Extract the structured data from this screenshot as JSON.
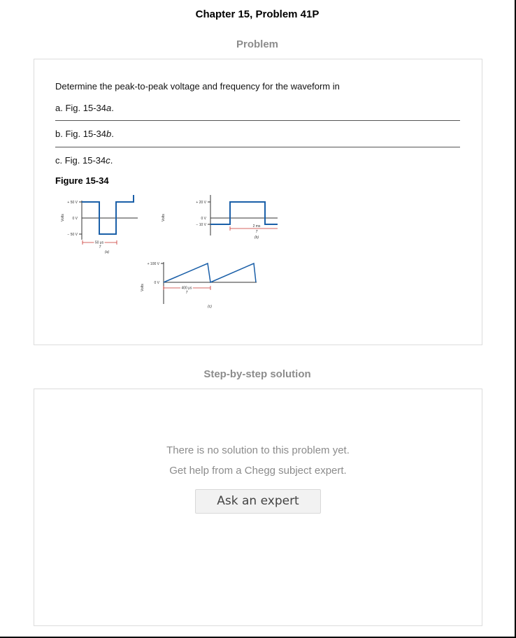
{
  "header": {
    "chapter_title": "Chapter 15, Problem 41P"
  },
  "problem": {
    "heading": "Problem",
    "statement": "Determine the peak-to-peak voltage and frequency for the waveform in",
    "parts": [
      {
        "prefix": "a. Fig. 15-34",
        "letter": "a",
        "suffix": "."
      },
      {
        "prefix": "b. Fig. 15-34",
        "letter": "b",
        "suffix": "."
      },
      {
        "prefix": "c. Fig. 15-34",
        "letter": "c",
        "suffix": "."
      }
    ],
    "figure": {
      "title": "Figure 15-34",
      "panel_a": {
        "y_pos": "+ 50 V",
        "y_zero": "0 V",
        "y_neg": "− 50 V",
        "axis": "Volts",
        "period": "50 μs",
        "period_symbol": "T",
        "caption": "(a)"
      },
      "panel_b": {
        "y_pos": "+ 20 V",
        "y_zero": "0 V",
        "y_neg": "− 10 V",
        "axis": "Volts",
        "period": "2 ms",
        "period_symbol": "T",
        "caption": "(b)"
      },
      "panel_c": {
        "y_pos": "+ 100 V",
        "y_zero": "0 V",
        "axis": "Volts",
        "period": "400 μs",
        "period_symbol": "T",
        "caption": "(c)"
      },
      "wave_color": "#1a5fa8",
      "marker_color": "#c8302c"
    }
  },
  "solution": {
    "heading": "Step-by-step solution",
    "message_line1": "There is no solution to this problem yet.",
    "message_line2": "Get help from a Chegg subject expert.",
    "ask_button": "Ask an expert"
  }
}
